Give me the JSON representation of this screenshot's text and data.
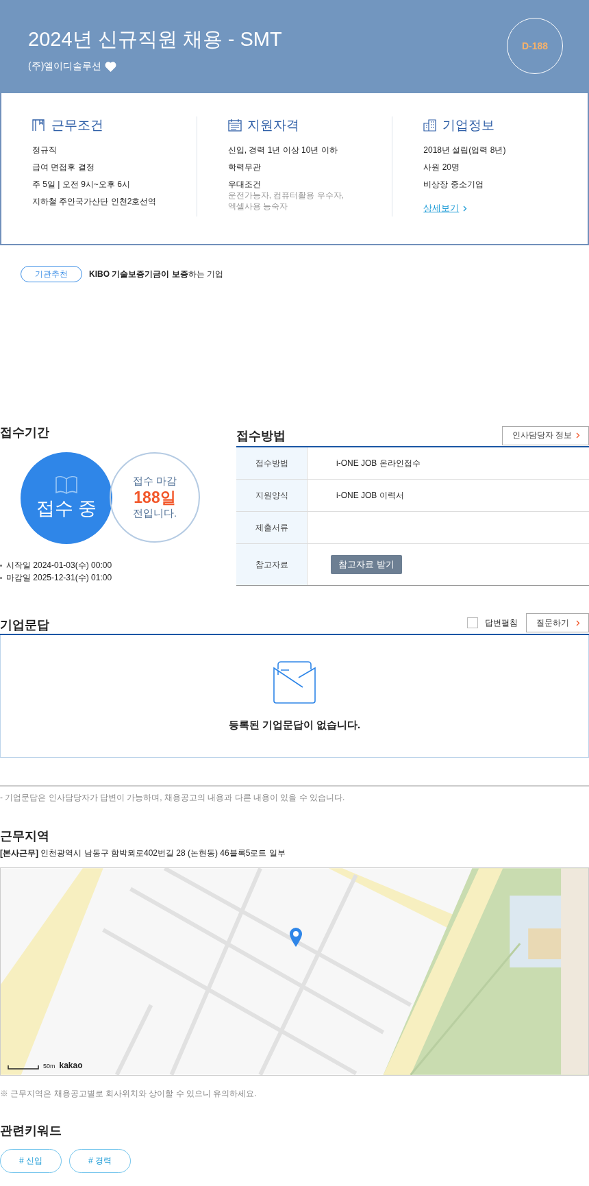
{
  "header": {
    "title": "2024년 신규직원 채용 - SMT",
    "company": "(주)엘이디솔루션",
    "favorite": true,
    "dday": "D-188"
  },
  "summary": [
    {
      "kind": "conditions",
      "title": "근무조건",
      "items": [
        {
          "label": "정규직"
        },
        {
          "label": "급여 면접후 결정"
        },
        {
          "label": "주 5일 | 오전 9시~오후 6시"
        },
        {
          "label": "지하철 주안국가산단 인천2호선역"
        }
      ]
    },
    {
      "kind": "qualifications",
      "title": "지원자격",
      "items": [
        {
          "label": "신입, 경력 1년 이상 10년 이하"
        },
        {
          "label": "학력무관"
        },
        {
          "label": "우대조건",
          "detail": "운전가능자, 컴퓨터활용 우수자, 엑셀사용 능숙자"
        }
      ]
    },
    {
      "kind": "company",
      "title": "기업정보",
      "items": [
        {
          "label": "2018년 설립(업력 8년)"
        },
        {
          "label": "사원 20명"
        },
        {
          "label": "비상장 중소기업"
        }
      ],
      "link": "상세보기"
    }
  ],
  "recommend": {
    "badge": "기관추천",
    "text": "**KIBO 기술보증기금이 보증**하는 기업"
  },
  "period": {
    "title": "접수기간",
    "status": "접수 중",
    "deadline_label": "접수 마감",
    "days": "188일",
    "suffix": "전입니다.",
    "dates": [
      "시작일 2024-01-03(수) 00:00",
      "마감일 2025-12-31(수) 01:00"
    ]
  },
  "method": {
    "title": "접수방법",
    "contact_button": "인사담당자 정보",
    "rows": [
      {
        "label": "접수방법",
        "value": "i-ONE JOB 온라인접수"
      },
      {
        "label": "지원양식",
        "value": "i-ONE JOB 이력서"
      },
      {
        "label": "제출서류"
      },
      {
        "label": "참고자료",
        "button": "참고자료 받기"
      }
    ]
  },
  "qna": {
    "title": "기업문답",
    "expand": {
      "label": "답변펼침",
      "checked": false
    },
    "ask_button": "질문하기",
    "empty": "등록된 기업문답이 없습니다.",
    "note": "- 기업문답은 인사담당자가 답변이 가능하며, 채용공고의 내용과 다른 내용이 있을 수 있습니다."
  },
  "location": {
    "title": "근무지역",
    "address": "**[본사근무]** 인천광역시 남동구 함박뫼로402번길 28 (논현동) 46블록5로트 일부",
    "map": {
      "kind": "picture",
      "scale": "50m",
      "attribution": "kakao"
    },
    "note": "※ 근무지역은 채용공고별로 회사위치와 상이할 수 있으니 유의하세요."
  },
  "keywords": {
    "title": "관련키워드",
    "tags": [
      "# 신입",
      "# 경력"
    ]
  }
}
